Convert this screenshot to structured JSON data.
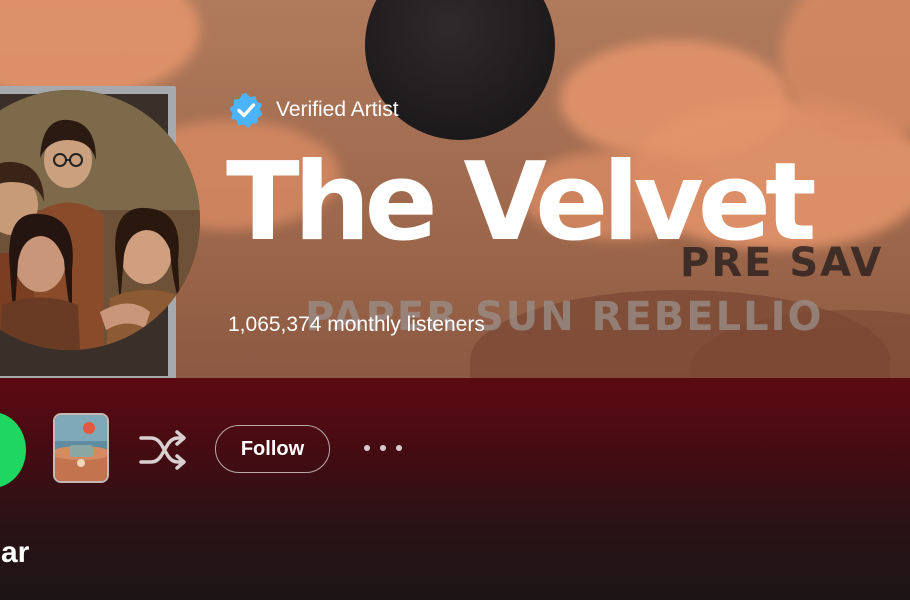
{
  "hero": {
    "verified_label": "Verified Artist",
    "artist_name": "The Velvet",
    "listeners": "1,065,374 monthly listeners",
    "background_text_line1": "PRE SAV",
    "background_text_line2": "PAPER SUN REBELLIO"
  },
  "actions": {
    "follow_label": "Follow"
  },
  "sections": {
    "popular_title": "pular"
  },
  "colors": {
    "spotify_green": "#1ed760",
    "verified_blue": "#4cb3ff",
    "header_red": "#5d0a12"
  },
  "icons": {
    "verified": "verified-badge-icon",
    "shuffle": "shuffle-icon",
    "more": "more-options-icon",
    "play": "play-icon"
  }
}
